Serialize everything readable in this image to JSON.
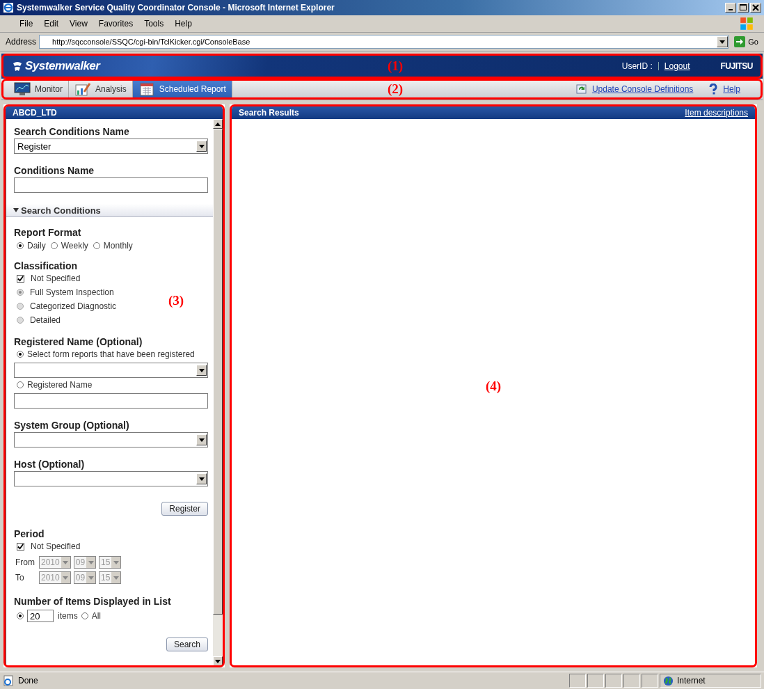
{
  "window": {
    "title": "Systemwalker Service Quality Coordinator Console - Microsoft Internet Explorer"
  },
  "menu": [
    "File",
    "Edit",
    "View",
    "Favorites",
    "Tools",
    "Help"
  ],
  "address": {
    "label": "Address",
    "url": "http://sqcconsole/SSQC/cgi-bin/TclKicker.cgi/ConsoleBase",
    "go": "Go"
  },
  "header": {
    "logo": "Systemwalker",
    "user_label": "UserID :",
    "logout": "Logout",
    "brand": "FUJITSU"
  },
  "tabs": [
    {
      "label": "Monitor",
      "selected": false,
      "kind": "monitor"
    },
    {
      "label": "Analysis",
      "selected": false,
      "kind": "analysis"
    },
    {
      "label": "Scheduled Report",
      "selected": true,
      "kind": "report"
    }
  ],
  "header_links": [
    {
      "label": "Update Console Definitions",
      "kind": "update"
    },
    {
      "label": "Help",
      "kind": "help"
    }
  ],
  "left_panel": {
    "title": "ABCD_LTD",
    "search_conditions_name": {
      "label": "Search Conditions Name",
      "value": "Register"
    },
    "conditions_name": {
      "label": "Conditions Name"
    },
    "search_conditions": {
      "label": "Search Conditions",
      "expanded": true
    },
    "report_format": {
      "label": "Report Format",
      "options": [
        {
          "label": "Daily",
          "selected": true
        },
        {
          "label": "Weekly",
          "selected": false
        },
        {
          "label": "Monthly",
          "selected": false
        }
      ]
    },
    "classification": {
      "label": "Classification",
      "not_specified": {
        "label": "Not Specified",
        "checked": true
      },
      "disabled": true,
      "options": [
        {
          "label": "Full System Inspection",
          "selected": true
        },
        {
          "label": "Categorized Diagnostic",
          "selected": false
        },
        {
          "label": "Detailed",
          "selected": false
        }
      ]
    },
    "registered_name": {
      "label": "Registered Name (Optional)",
      "options": [
        {
          "label": "Select form reports that have been registered",
          "selected": true
        },
        {
          "label": "Registered Name",
          "selected": false
        }
      ]
    },
    "system_group": {
      "label": "System Group (Optional)"
    },
    "host": {
      "label": "Host (Optional)"
    },
    "register_button": "Register",
    "period": {
      "label": "Period",
      "not_specified": {
        "label": "Not Specified",
        "checked": true
      },
      "disabled": true,
      "rows": [
        {
          "label": "From",
          "year": "2010",
          "month": "09",
          "day": "15"
        },
        {
          "label": "To",
          "year": "2010",
          "month": "09",
          "day": "15"
        }
      ]
    },
    "items_count": {
      "label": "Number of Items Displayed in List",
      "count": {
        "selected": true,
        "value": "20",
        "unit": "items"
      },
      "all": {
        "label": "All",
        "selected": false
      }
    },
    "search_button": "Search"
  },
  "results": {
    "title": "Search Results",
    "link": "Item descriptions"
  },
  "status_bar": {
    "text": "Done",
    "zone": "Internet"
  },
  "callouts": [
    "(1)",
    "(2)",
    "(3)",
    "(4)"
  ]
}
